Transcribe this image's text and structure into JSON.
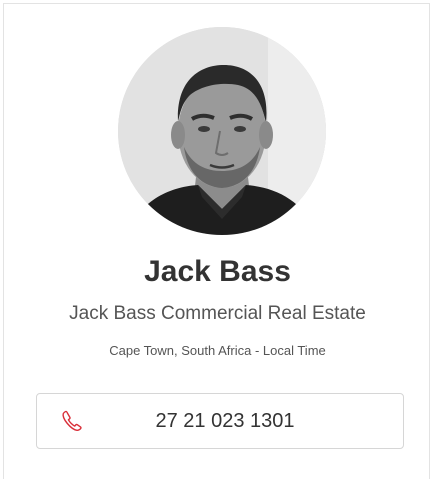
{
  "profile": {
    "name": "Jack Bass",
    "company": "Jack Bass Commercial Real Estate",
    "location": "Cape Town, South Africa - Local Time",
    "photo_icon": "person-portrait"
  },
  "contact": {
    "phone": "27 21 023 1301",
    "phone_icon": "phone-icon",
    "icon_color": "#d9303a"
  }
}
